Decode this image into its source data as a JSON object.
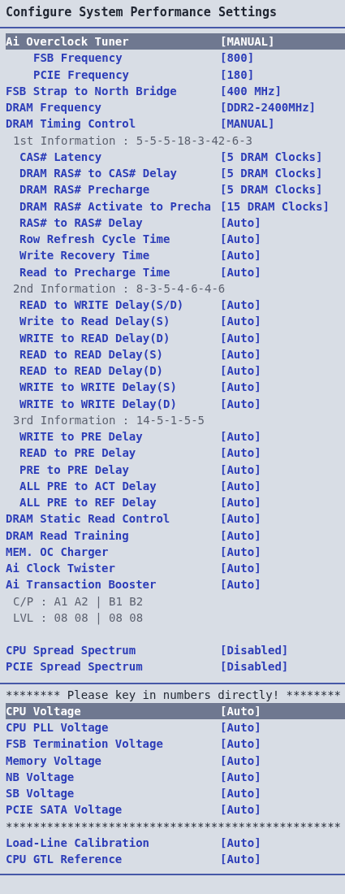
{
  "title": "Configure System Performance Settings",
  "groups": [
    {
      "rule": false,
      "gap": false,
      "rows": [
        {
          "kind": "setting",
          "label": "Ai Overclock Tuner",
          "value": "[MANUAL]",
          "highlighted": true,
          "children": [
            {
              "kind": "setting",
              "label": "FSB Frequency",
              "value": "[800]",
              "highlighted": false
            },
            {
              "kind": "setting",
              "label": "PCIE Frequency",
              "value": "[180]",
              "highlighted": false
            }
          ]
        },
        {
          "kind": "setting",
          "label": "FSB Strap to North Bridge",
          "value": "[400 MHz]",
          "highlighted": false
        },
        {
          "kind": "setting",
          "label": "DRAM Frequency",
          "value": "[DDR2-2400MHz]",
          "highlighted": false
        },
        {
          "kind": "setting",
          "label": "DRAM Timing Control",
          "value": "[MANUAL]",
          "highlighted": false,
          "children": [
            {
              "kind": "info",
              "text": "1st Information : 5-5-5-18-3-42-6-3",
              "children": [
                {
                  "kind": "setting",
                  "label": "CAS# Latency",
                  "value": "[5 DRAM Clocks]",
                  "highlighted": false
                },
                {
                  "kind": "setting",
                  "label": "DRAM RAS# to CAS# Delay",
                  "value": "[5 DRAM Clocks]",
                  "highlighted": false
                },
                {
                  "kind": "setting",
                  "label": "DRAM RAS# Precharge",
                  "value": "[5 DRAM Clocks]",
                  "highlighted": false
                },
                {
                  "kind": "setting",
                  "label": "DRAM RAS# Activate to Precha",
                  "value": "[15 DRAM Clocks]",
                  "highlighted": false
                },
                {
                  "kind": "setting",
                  "label": "RAS# to RAS# Delay",
                  "value": "[Auto]",
                  "highlighted": false
                },
                {
                  "kind": "setting",
                  "label": "Row Refresh Cycle Time",
                  "value": "[Auto]",
                  "highlighted": false
                },
                {
                  "kind": "setting",
                  "label": "Write Recovery Time",
                  "value": "[Auto]",
                  "highlighted": false
                },
                {
                  "kind": "setting",
                  "label": "Read to Precharge Time",
                  "value": "[Auto]",
                  "highlighted": false
                }
              ]
            },
            {
              "kind": "info",
              "text": "2nd Information : 8-3-5-4-6-4-6",
              "children": [
                {
                  "kind": "setting",
                  "label": "READ to WRITE Delay(S/D)",
                  "value": "[Auto]",
                  "highlighted": false
                },
                {
                  "kind": "setting",
                  "label": "Write to Read Delay(S)",
                  "value": "[Auto]",
                  "highlighted": false
                },
                {
                  "kind": "setting",
                  "label": "WRITE to READ Delay(D)",
                  "value": "[Auto]",
                  "highlighted": false
                },
                {
                  "kind": "setting",
                  "label": "READ to READ Delay(S)",
                  "value": "[Auto]",
                  "highlighted": false
                },
                {
                  "kind": "setting",
                  "label": "READ to READ Delay(D)",
                  "value": "[Auto]",
                  "highlighted": false
                },
                {
                  "kind": "setting",
                  "label": "WRITE to WRITE Delay(S)",
                  "value": "[Auto]",
                  "highlighted": false
                },
                {
                  "kind": "setting",
                  "label": "WRITE to WRITE Delay(D)",
                  "value": "[Auto]",
                  "highlighted": false
                }
              ]
            },
            {
              "kind": "info",
              "text": "3rd Information : 14-5-1-5-5",
              "children": [
                {
                  "kind": "setting",
                  "label": "WRITE to PRE Delay",
                  "value": "[Auto]",
                  "highlighted": false
                },
                {
                  "kind": "setting",
                  "label": "READ to PRE Delay",
                  "value": "[Auto]",
                  "highlighted": false
                },
                {
                  "kind": "setting",
                  "label": "PRE to PRE Delay",
                  "value": "[Auto]",
                  "highlighted": false
                },
                {
                  "kind": "setting",
                  "label": "ALL PRE to ACT Delay",
                  "value": "[Auto]",
                  "highlighted": false
                },
                {
                  "kind": "setting",
                  "label": "ALL PRE to REF Delay",
                  "value": "[Auto]",
                  "highlighted": false
                }
              ]
            }
          ]
        },
        {
          "kind": "setting",
          "label": "DRAM Static Read Control",
          "value": "[Auto]",
          "highlighted": false
        },
        {
          "kind": "setting",
          "label": "DRAM Read Training",
          "value": "[Auto]",
          "highlighted": false
        },
        {
          "kind": "setting",
          "label": "MEM. OC Charger",
          "value": "[Auto]",
          "highlighted": false
        },
        {
          "kind": "setting",
          "label": "Ai Clock Twister",
          "value": "[Auto]",
          "highlighted": false
        },
        {
          "kind": "setting",
          "label": "Ai Transaction Booster",
          "value": "[Auto]",
          "highlighted": false,
          "children": [
            {
              "kind": "info",
              "text": "C/P : A1 A2 | B1 B2"
            },
            {
              "kind": "info",
              "text": "LVL : 08 08 | 08 08"
            }
          ]
        }
      ]
    },
    {
      "rule": false,
      "gap": true,
      "rows": [
        {
          "kind": "setting",
          "label": "CPU Spread Spectrum",
          "value": "[Disabled]",
          "highlighted": false
        },
        {
          "kind": "setting",
          "label": "PCIE Spread Spectrum",
          "value": "[Disabled]",
          "highlighted": false
        }
      ]
    },
    {
      "rule": true,
      "gap": false,
      "rows": [
        {
          "kind": "notice",
          "text": "******** Please key in numbers directly! ********"
        },
        {
          "kind": "setting",
          "label": "CPU Voltage",
          "value": "[Auto]",
          "highlighted": true
        },
        {
          "kind": "setting",
          "label": "CPU PLL Voltage",
          "value": "[Auto]",
          "highlighted": false
        },
        {
          "kind": "setting",
          "label": "FSB Termination Voltage",
          "value": "[Auto]",
          "highlighted": false
        },
        {
          "kind": "setting",
          "label": "Memory Voltage",
          "value": "[Auto]",
          "highlighted": false
        },
        {
          "kind": "setting",
          "label": "NB Voltage",
          "value": "[Auto]",
          "highlighted": false
        },
        {
          "kind": "setting",
          "label": "SB Voltage",
          "value": "[Auto]",
          "highlighted": false
        },
        {
          "kind": "setting",
          "label": "PCIE SATA Voltage",
          "value": "[Auto]",
          "highlighted": false
        },
        {
          "kind": "notice",
          "text": "*************************************************"
        },
        {
          "kind": "setting",
          "label": "Load-Line Calibration",
          "value": "[Auto]",
          "highlighted": false
        },
        {
          "kind": "setting",
          "label": "CPU GTL Reference",
          "value": "[Auto]",
          "highlighted": false
        }
      ]
    }
  ]
}
